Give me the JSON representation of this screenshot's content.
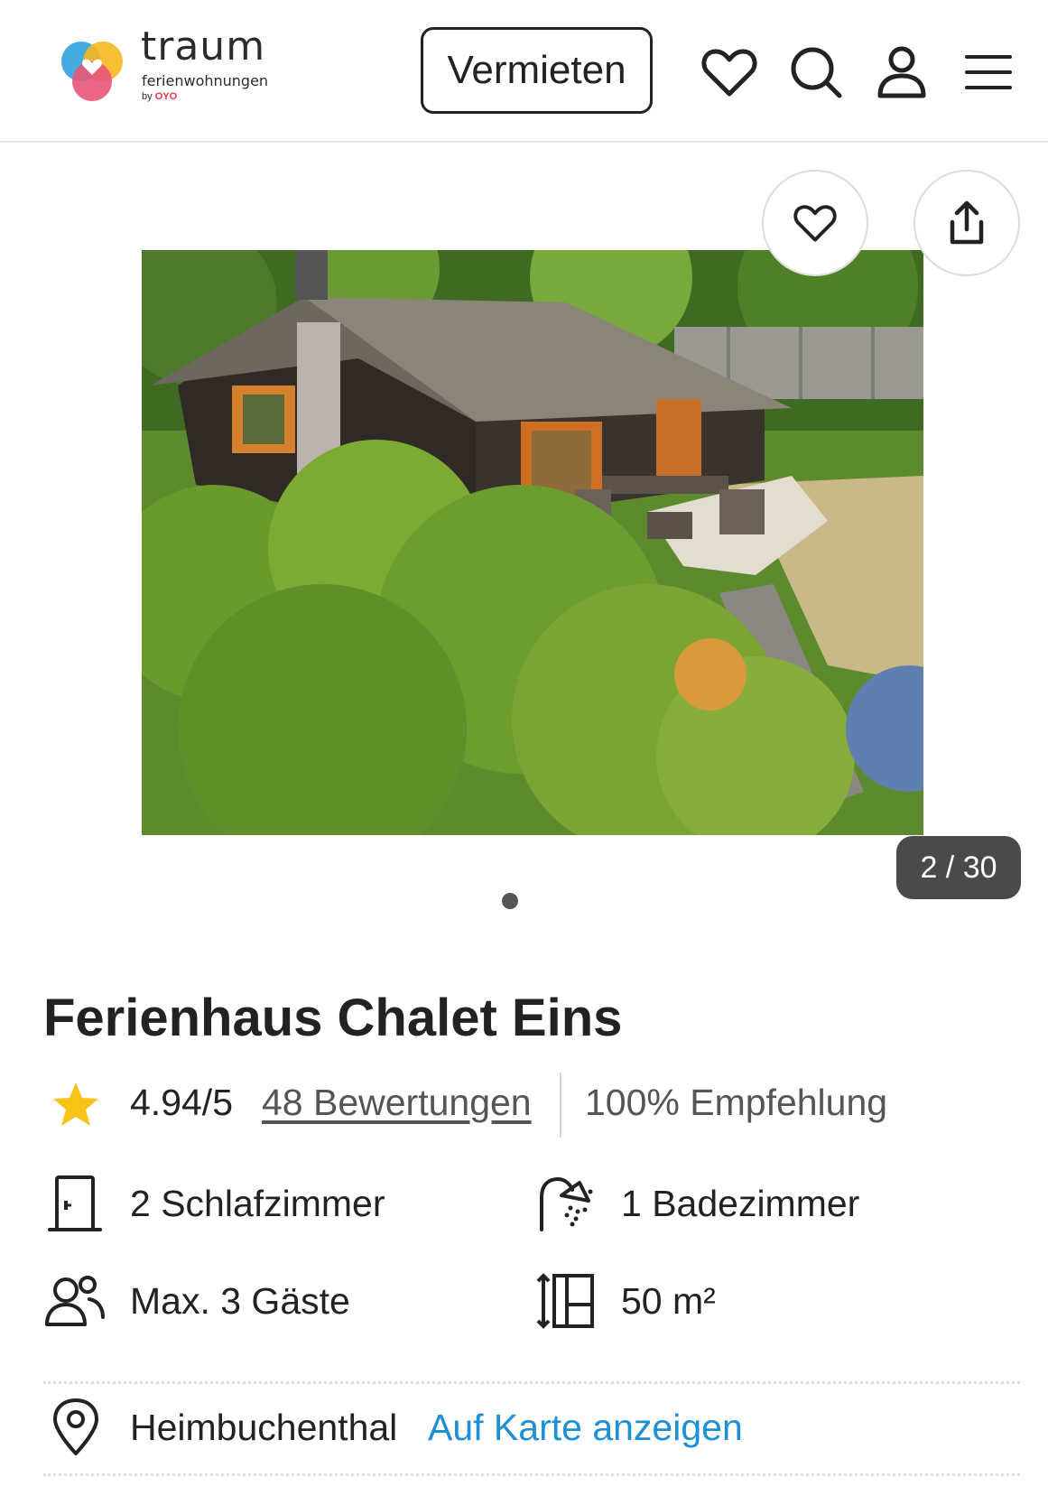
{
  "header": {
    "logo": {
      "word": "traum",
      "sub": "ferienwohnungen",
      "by": "by",
      "brand": "OYO"
    },
    "rent_button": "Vermieten",
    "icons": [
      "heart-icon",
      "search-icon",
      "user-icon",
      "menu-icon"
    ]
  },
  "gallery": {
    "counter": "2 / 30",
    "favorite_icon": "heart-icon",
    "share_icon": "share-icon",
    "photo_alt": "Ferienhaus Chalet Eins"
  },
  "listing": {
    "title": "Ferienhaus Chalet Eins",
    "rating": "4.94/5",
    "reviews": "48 Bewertungen",
    "recommendation": "100% Empfehlung",
    "features": {
      "bedrooms": "2 Schlafzimmer",
      "bathrooms": "1 Badezimmer",
      "guests": "Max. 3 Gäste",
      "area": "50 m²"
    },
    "location": "Heimbuchenthal",
    "map_link": "Auf Karte anzeigen"
  },
  "colors": {
    "accent_link": "#1e8fd6",
    "star": "#f7c316",
    "text": "#222222",
    "muted": "#555555",
    "counter_bg": "#4a4a4a"
  }
}
